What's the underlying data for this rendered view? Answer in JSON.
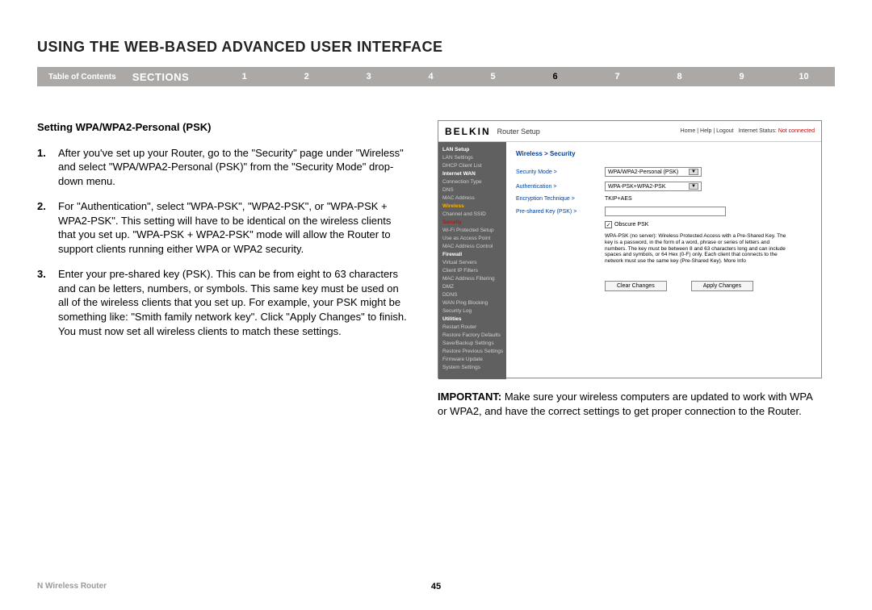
{
  "page_title": "USING THE WEB-BASED ADVANCED USER INTERFACE",
  "nav": {
    "toc": "Table of Contents",
    "sections": "SECTIONS",
    "numbers": [
      "1",
      "2",
      "3",
      "4",
      "5",
      "6",
      "7",
      "8",
      "9",
      "10"
    ],
    "active": "6"
  },
  "subhead": "Setting WPA/WPA2-Personal (PSK)",
  "steps": [
    {
      "n": "1.",
      "text": "After you've set up your Router, go to the \"Security\" page under \"Wireless\" and select \"WPA/WPA2-Personal (PSK)\" from the \"Security Mode\" drop-down menu."
    },
    {
      "n": "2.",
      "text": "For \"Authentication\", select \"WPA-PSK\", \"WPA2-PSK\", or \"WPA-PSK + WPA2-PSK\". This setting will have to be identical on the wireless clients that you set up. \"WPA-PSK + WPA2-PSK\" mode will allow the Router to support clients running either WPA or WPA2 security."
    },
    {
      "n": "3.",
      "text": "Enter your pre-shared key (PSK). This can be from eight to 63 characters and can be letters, numbers, or symbols. This same key must be used on all of the wireless clients that you set up. For example, your PSK might be something like: \"Smith family network key\". Click \"Apply Changes\" to finish. You must now set all wireless clients to match these settings."
    }
  ],
  "screenshot": {
    "logo": "BELKIN",
    "router_setup": "Router Setup",
    "top_links": "Home | Help | Logout",
    "internet_status_label": "Internet Status:",
    "internet_status_value": "Not connected",
    "sidebar": [
      {
        "t": "LAN Setup",
        "cls": "cat"
      },
      {
        "t": "LAN Settings"
      },
      {
        "t": "DHCP Client List"
      },
      {
        "t": "Internet WAN",
        "cls": "cat"
      },
      {
        "t": "Connection Type"
      },
      {
        "t": "DNS"
      },
      {
        "t": "MAC Address"
      },
      {
        "t": "Wireless",
        "cls": "wireless-active"
      },
      {
        "t": "Channel and SSID"
      },
      {
        "t": "Security",
        "cls": "security-active"
      },
      {
        "t": "Wi-Fi Protected Setup"
      },
      {
        "t": "Use as Access Point"
      },
      {
        "t": "MAC Address Control"
      },
      {
        "t": "Firewall",
        "cls": "cat"
      },
      {
        "t": "Virtual Servers"
      },
      {
        "t": "Client IP Filters"
      },
      {
        "t": "MAC Address Filtering"
      },
      {
        "t": "DMZ"
      },
      {
        "t": "DDNS"
      },
      {
        "t": "WAN Ping Blocking"
      },
      {
        "t": "Security Log"
      },
      {
        "t": "Utilities",
        "cls": "cat"
      },
      {
        "t": "Restart Router"
      },
      {
        "t": "Restore Factory Defaults"
      },
      {
        "t": "Save/Backup Settings"
      },
      {
        "t": "Restore Previous Settings"
      },
      {
        "t": "Firmware Update"
      },
      {
        "t": "System Settings"
      }
    ],
    "breadcrumb": "Wireless > Security",
    "rows": {
      "security_mode_label": "Security Mode >",
      "security_mode_value": "WPA/WPA2-Personal (PSK)",
      "auth_label": "Authentication >",
      "auth_value": "WPA-PSK+WPA2-PSK",
      "enc_label": "Encryption Technique >",
      "enc_value": "TKIP+AES",
      "psk_label": "Pre-shared Key (PSK) >",
      "obscure": "Obscure PSK",
      "help": "WPA-PSK (no server): Wireless Protected Access with a Pre-Shared Key. The key is a password, in the form of a word, phrase or series of letters and numbers. The key must be between 8 and 63 characters long and can include spaces and symbols, or 64 Hex (0-F) only. Each client that connects to the network must use the same key (Pre-Shared Key). More Info",
      "btn_clear": "Clear Changes",
      "btn_apply": "Apply Changes"
    }
  },
  "important": "IMPORTANT: Make sure your wireless computers are updated to work with WPA or WPA2, and have the correct settings to get proper connection to the Router.",
  "footer_left": "N Wireless Router",
  "page_number": "45"
}
